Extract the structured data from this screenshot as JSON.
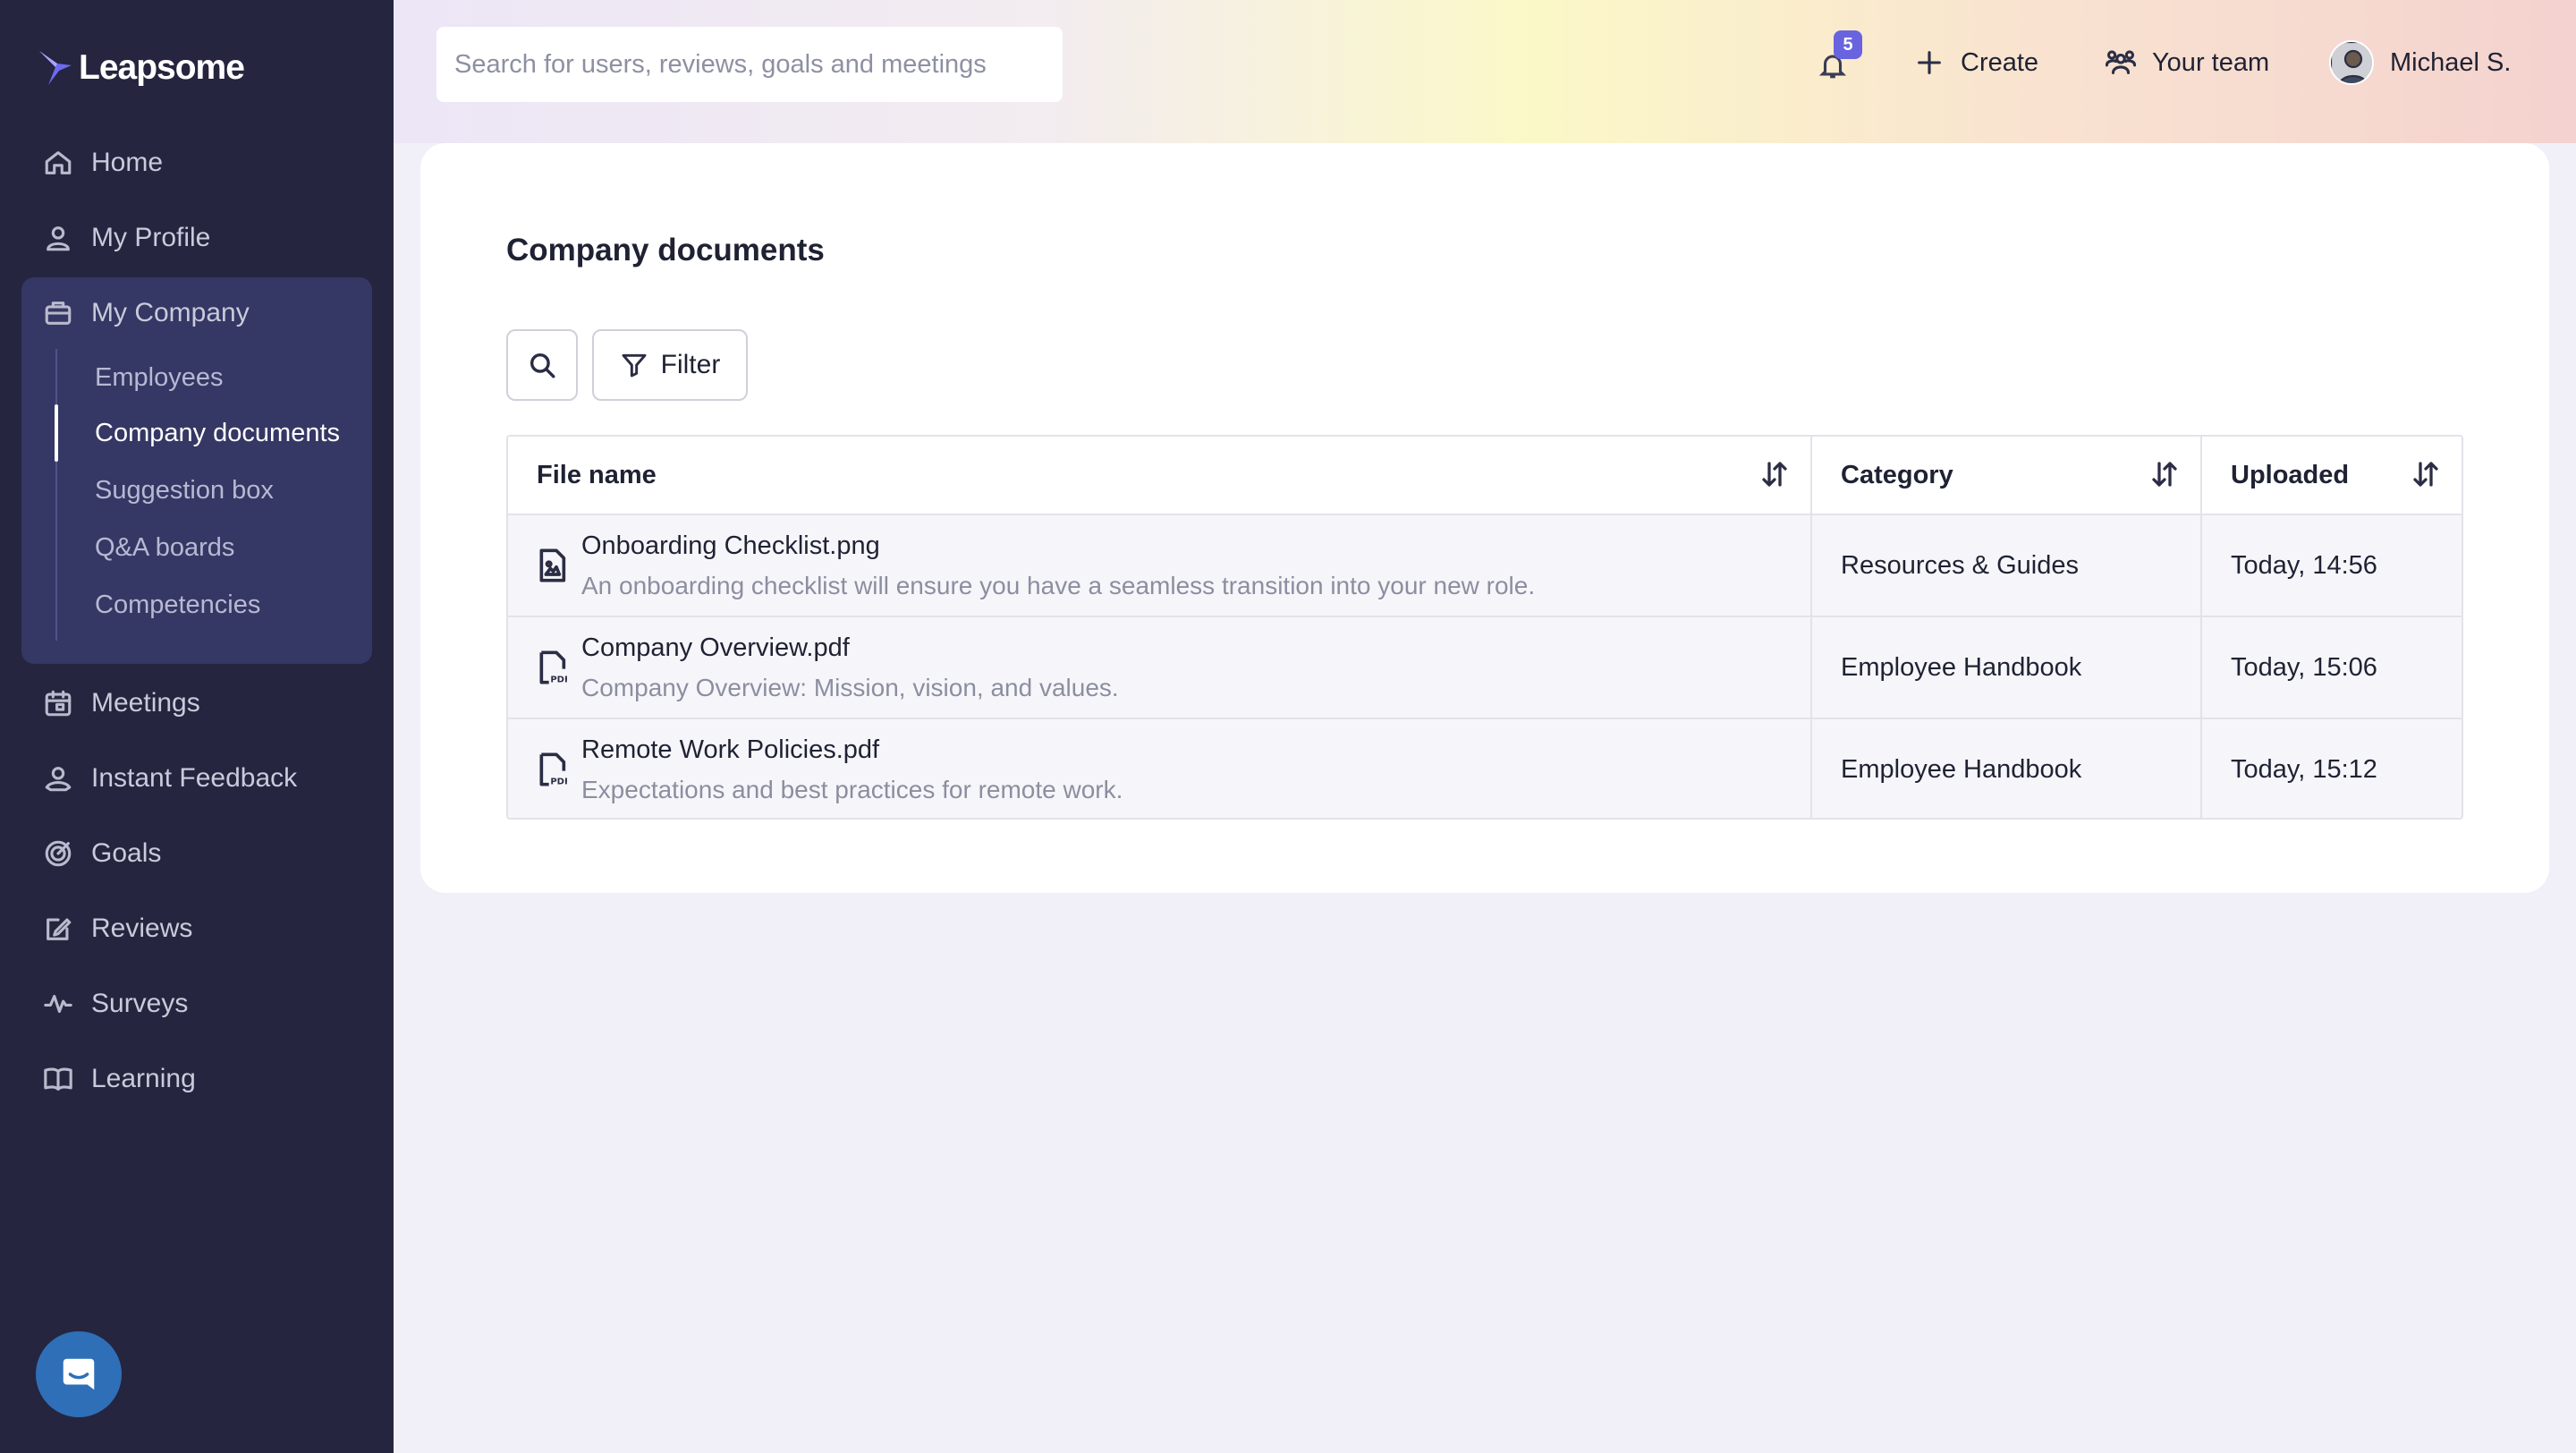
{
  "app": {
    "name": "Leapsome"
  },
  "sidebar": {
    "items": [
      {
        "label": "Home",
        "icon": "home-icon"
      },
      {
        "label": "My Profile",
        "icon": "user-icon"
      },
      {
        "label": "My Company",
        "icon": "briefcase-icon"
      },
      {
        "label": "Meetings",
        "icon": "calendar-icon"
      },
      {
        "label": "Instant Feedback",
        "icon": "feedback-icon"
      },
      {
        "label": "Goals",
        "icon": "target-icon"
      },
      {
        "label": "Reviews",
        "icon": "edit-icon"
      },
      {
        "label": "Surveys",
        "icon": "pulse-icon"
      },
      {
        "label": "Learning",
        "icon": "book-icon"
      }
    ],
    "company_sub": [
      {
        "label": "Employees"
      },
      {
        "label": "Company documents"
      },
      {
        "label": "Suggestion box"
      },
      {
        "label": "Q&A boards"
      },
      {
        "label": "Competencies"
      }
    ],
    "active_sub": "Company documents"
  },
  "topbar": {
    "search_placeholder": "Search for users, reviews, goals and meetings",
    "notifications_count": "5",
    "create_label": "Create",
    "team_label": "Your team",
    "user_name": "Michael S."
  },
  "main": {
    "title": "Company documents",
    "filter_label": "Filter",
    "table": {
      "columns": [
        "File name",
        "Category",
        "Uploaded"
      ],
      "rows": [
        {
          "file_name": "Onboarding Checklist.png",
          "description": "An onboarding checklist will ensure you have a seamless transition into your new role.",
          "category": "Resources & Guides",
          "uploaded": "Today, 14:56",
          "file_type": "image-file-icon"
        },
        {
          "file_name": "Company Overview.pdf",
          "description": "Company Overview: Mission, vision, and values.",
          "category": "Employee Handbook",
          "uploaded": "Today, 15:06",
          "file_type": "pdf-file-icon"
        },
        {
          "file_name": "Remote Work Policies.pdf",
          "description": "Expectations and best practices for remote work.",
          "category": "Employee Handbook",
          "uploaded": "Today, 15:12",
          "file_type": "pdf-file-icon"
        }
      ]
    }
  },
  "colors": {
    "sidebar_bg": "#25253f",
    "sidebar_active_bg": "#353764",
    "badge": "#6a63e0",
    "chat_button": "#2f6fb8"
  }
}
